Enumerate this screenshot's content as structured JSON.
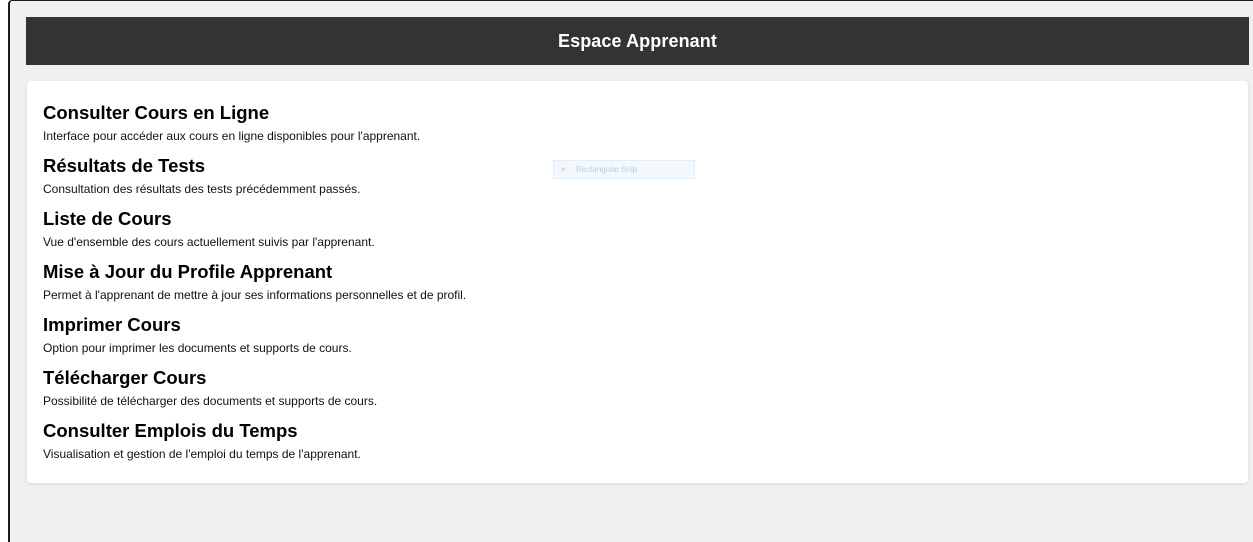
{
  "header": {
    "title": "Espace Apprenant"
  },
  "features": [
    {
      "title": "Consulter Cours en Ligne",
      "description": "Interface pour accéder aux cours en ligne disponibles pour l'apprenant."
    },
    {
      "title": "Résultats de Tests",
      "description": "Consultation des résultats des tests précédemment passés."
    },
    {
      "title": "Liste de Cours",
      "description": "Vue d'ensemble des cours actuellement suivis par l'apprenant."
    },
    {
      "title": "Mise à Jour du Profile Apprenant",
      "description": "Permet à l'apprenant de mettre à jour ses informations personnelles et de profil."
    },
    {
      "title": "Imprimer Cours",
      "description": "Option pour imprimer les documents et supports de cours."
    },
    {
      "title": "Télécharger Cours",
      "description": "Possibilité de télécharger des documents et supports de cours."
    },
    {
      "title": "Consulter Emplois du Temps",
      "description": "Visualisation et gestion de l'emploi du temps de l'apprenant."
    }
  ],
  "overlay": {
    "label": "Rectangular Snip",
    "icon": "close-icon"
  },
  "colors": {
    "header_bg": "#333333",
    "header_text": "#ffffff",
    "page_bg": "#f0f0f0",
    "panel_bg": "#ffffff"
  }
}
